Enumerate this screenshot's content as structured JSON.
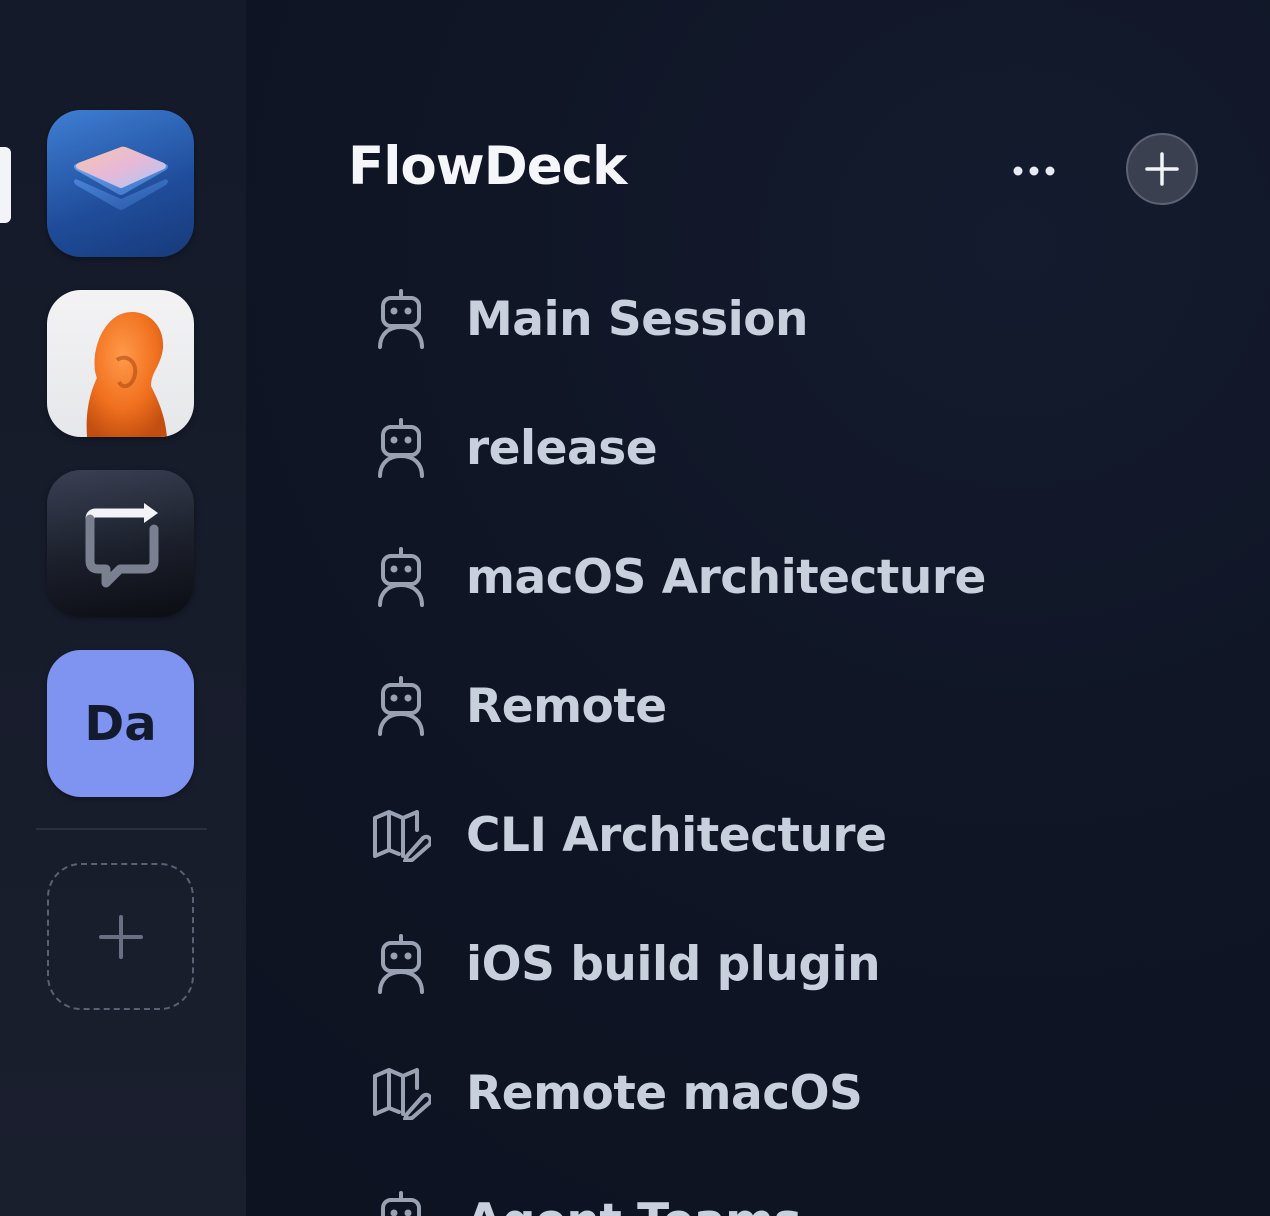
{
  "rail": {
    "apps": [
      {
        "name": "FlowDeck",
        "icon": "layers-stack-icon",
        "active": true
      },
      {
        "name": "orange-figure-app",
        "icon": "orange-figure-icon"
      },
      {
        "name": "sync-chat-app",
        "icon": "chat-sync-icon"
      },
      {
        "name": "Da",
        "label": "Da",
        "color": "#7e94f0"
      }
    ],
    "add_workspace_icon": "plus-icon"
  },
  "header": {
    "title": "FlowDeck",
    "more_icon": "ellipsis-icon",
    "add_icon": "plus-icon"
  },
  "sessions": [
    {
      "label": "Main Session",
      "icon": "robot-icon"
    },
    {
      "label": "release",
      "icon": "robot-icon"
    },
    {
      "label": "macOS Architecture",
      "icon": "robot-icon"
    },
    {
      "label": "Remote",
      "icon": "robot-icon"
    },
    {
      "label": "CLI Architecture",
      "icon": "map-edit-icon"
    },
    {
      "label": "iOS build plugin",
      "icon": "robot-icon"
    },
    {
      "label": "Remote macOS",
      "icon": "map-edit-icon"
    },
    {
      "label": "Agent Teams",
      "icon": "robot-icon"
    }
  ],
  "colors": {
    "accent": "#7e94f0",
    "background": "#0f1524",
    "rail": "#171c2b",
    "text": "#c8cfdd"
  }
}
